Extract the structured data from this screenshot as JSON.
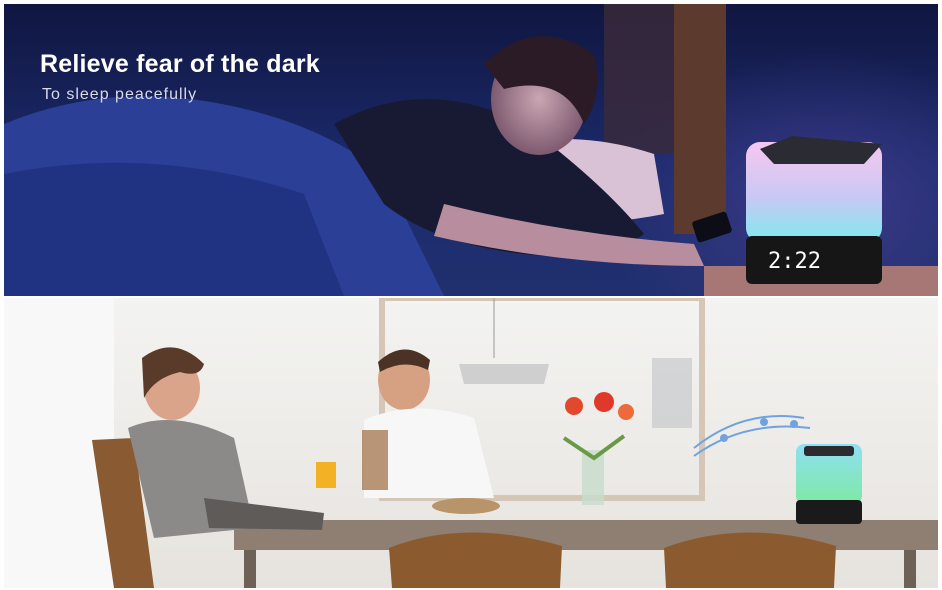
{
  "top_panel": {
    "headline": "Relieve fear of the dark",
    "subline": "To sleep peacefully"
  },
  "lamp": {
    "clock_display": "2:22"
  },
  "colors": {
    "night_blue": "#1b2a6b",
    "lamp_glow_top": "#f6c7ef",
    "lamp_glow_bottom": "#7fe9ef",
    "wood": "#8a5a33"
  }
}
